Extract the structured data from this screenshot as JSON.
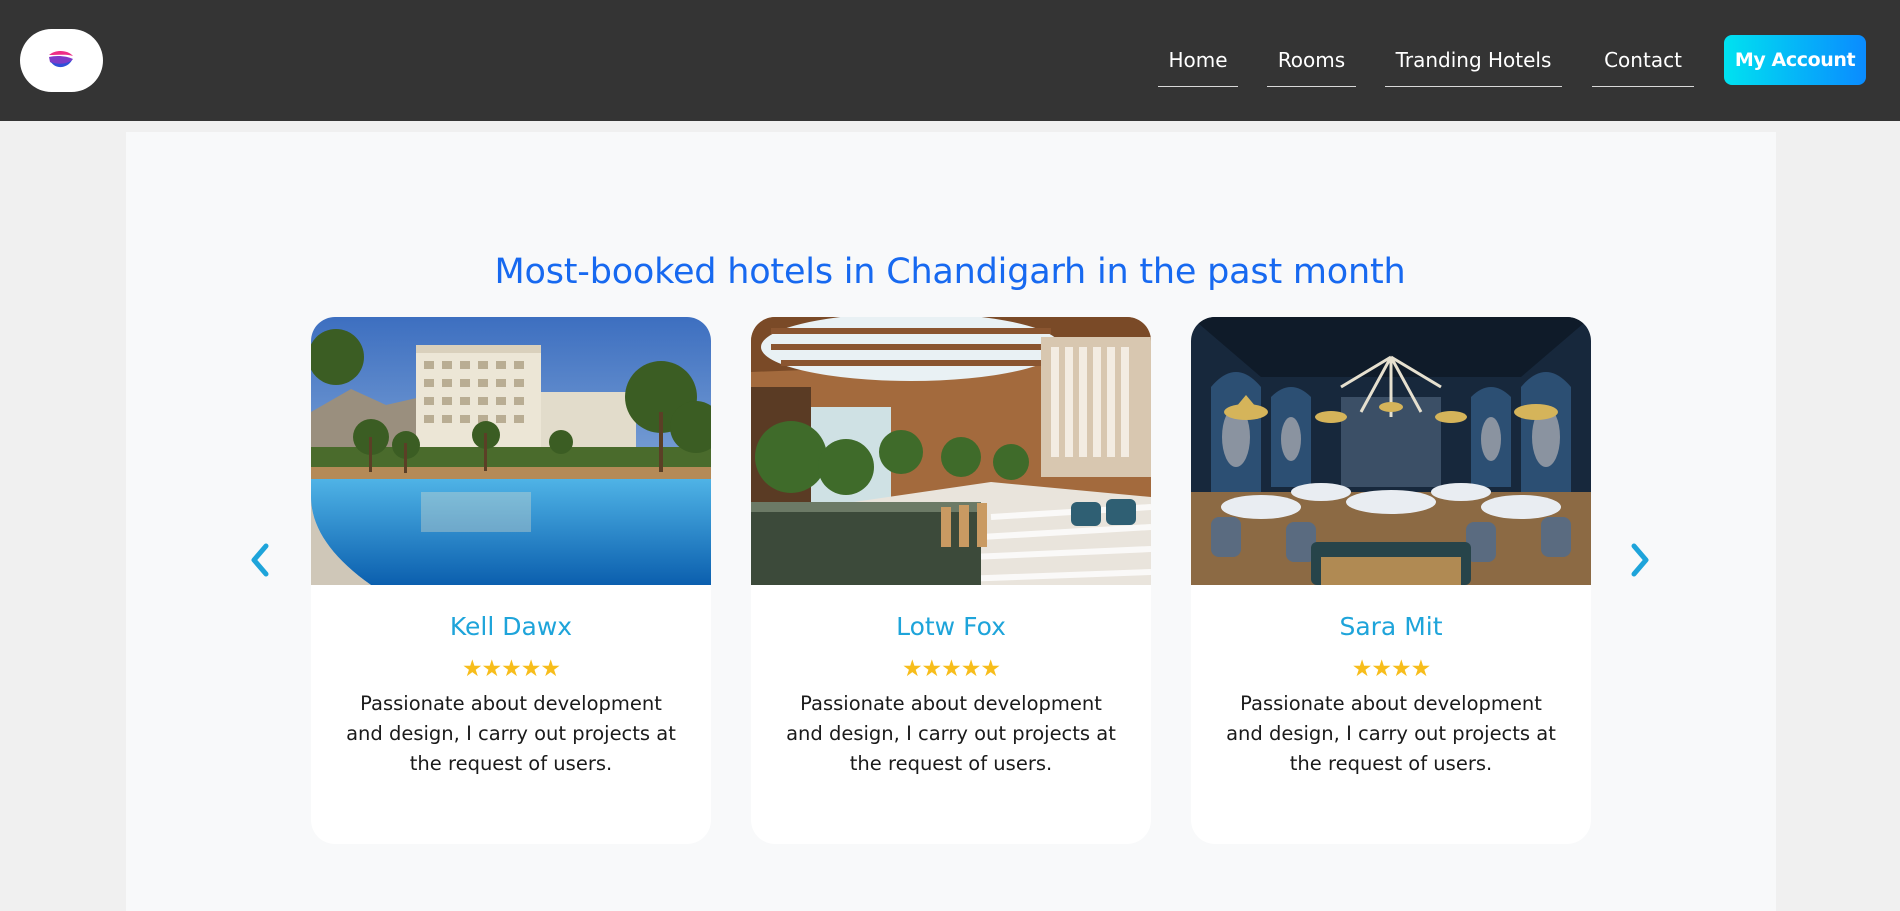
{
  "nav": {
    "links": [
      "Home",
      "Rooms",
      "Tranding Hotels",
      "Contact"
    ],
    "account_label": "My Account",
    "accent_gradient": [
      "#00e2f0",
      "#0a8bff"
    ]
  },
  "section": {
    "title": "Most-booked hotels in Chandigarh in the past month",
    "title_color": "#1769f0"
  },
  "hotels": [
    {
      "name": "Kell Dawx",
      "rating": 5,
      "stars": "★★★★★",
      "description": "Passionate about development and design, I carry out projects at the request of users.",
      "image": "resort-pool-photo"
    },
    {
      "name": "Lotw Fox",
      "rating": 5,
      "stars": "★★★★★",
      "description": "Passionate about development and design, I carry out projects at the request of users.",
      "image": "atrium-garden-lounge-photo"
    },
    {
      "name": "Sara Mit",
      "rating": 4,
      "stars": "★★★★",
      "description": "Passionate about development and design, I carry out projects at the request of users.",
      "image": "restaurant-dining-room-photo"
    }
  ],
  "icons": {
    "logo": "brand-logo-icon",
    "prev": "chevron-left-icon",
    "next": "chevron-right-icon"
  },
  "colors": {
    "navbar": "#343434",
    "hotel_name": "#1ea4da",
    "stars": "#f7bd1b",
    "arrow": "#1ea4da"
  }
}
